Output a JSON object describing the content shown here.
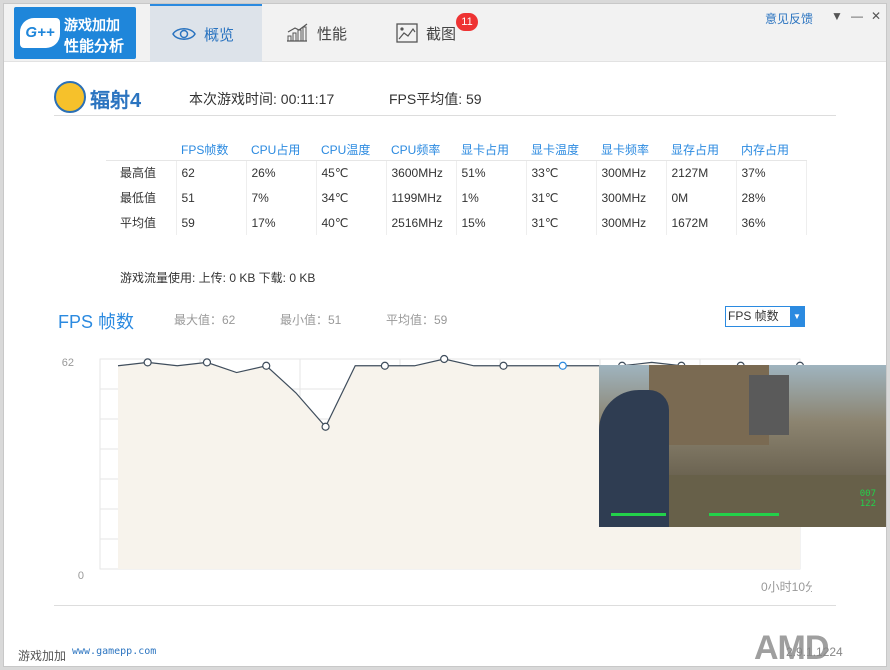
{
  "app": {
    "logo_badge": "G++",
    "logo_line1": "游戏加加",
    "logo_line2": "性能分析",
    "feedback": "意见反馈"
  },
  "tabs": [
    {
      "label": "概览",
      "icon": "eye-icon",
      "active": true
    },
    {
      "label": "性能",
      "icon": "bar-chart-icon",
      "active": false
    },
    {
      "label": "截图",
      "icon": "picture-icon",
      "active": false,
      "badge": "11"
    }
  ],
  "game": {
    "title": "辐射4",
    "session_time": "本次游戏时间: 00:11:17",
    "fps_avg": "FPS平均值: 59"
  },
  "stats": {
    "headers": [
      "FPS帧数",
      "CPU占用",
      "CPU温度",
      "CPU频率",
      "显卡占用",
      "显卡温度",
      "显卡频率",
      "显存占用",
      "内存占用"
    ],
    "rows": [
      {
        "label": "最高值",
        "values": [
          "62",
          "26%",
          "45℃",
          "3600MHz",
          "51%",
          "33℃",
          "300MHz",
          "2127M",
          "37%"
        ]
      },
      {
        "label": "最低值",
        "values": [
          "51",
          "7%",
          "34℃",
          "1199MHz",
          "1%",
          "31℃",
          "300MHz",
          "0M",
          "28%"
        ]
      },
      {
        "label": "平均值",
        "values": [
          "59",
          "17%",
          "40℃",
          "2516MHz",
          "15%",
          "31℃",
          "300MHz",
          "1672M",
          "36%"
        ]
      }
    ]
  },
  "traffic": "游戏流量使用: 上传: 0 KB   下载: 0 KB",
  "fps_section": {
    "title": "FPS 帧数",
    "max": "最大值：62",
    "min": "最小值：51",
    "avg": "平均值：59",
    "select_value": "FPS 帧数"
  },
  "chart_data": {
    "type": "line",
    "y_tick_labels": [
      "62",
      "0"
    ],
    "x_end_label": "0小时10分钟",
    "ylim": [
      0,
      62
    ],
    "series": [
      {
        "values": [
          60,
          61,
          60,
          61,
          58,
          60,
          52,
          42,
          60,
          60,
          60,
          62,
          60,
          60,
          60,
          60,
          60,
          60,
          61,
          60,
          60,
          60,
          60,
          60
        ],
        "markers": [
          1,
          3,
          5,
          7,
          9,
          11,
          13,
          15,
          17,
          19,
          21,
          23
        ]
      }
    ],
    "colors": {
      "line": "#3f4d5c",
      "fill": "#f7f3ec",
      "grid": "#e6e6e6",
      "highlight": "#2b8ae0"
    }
  },
  "footer": {
    "name": "游戏加加",
    "url": "www.gamepp.com",
    "version": "2.9.1.1224",
    "brand": "AMD"
  }
}
